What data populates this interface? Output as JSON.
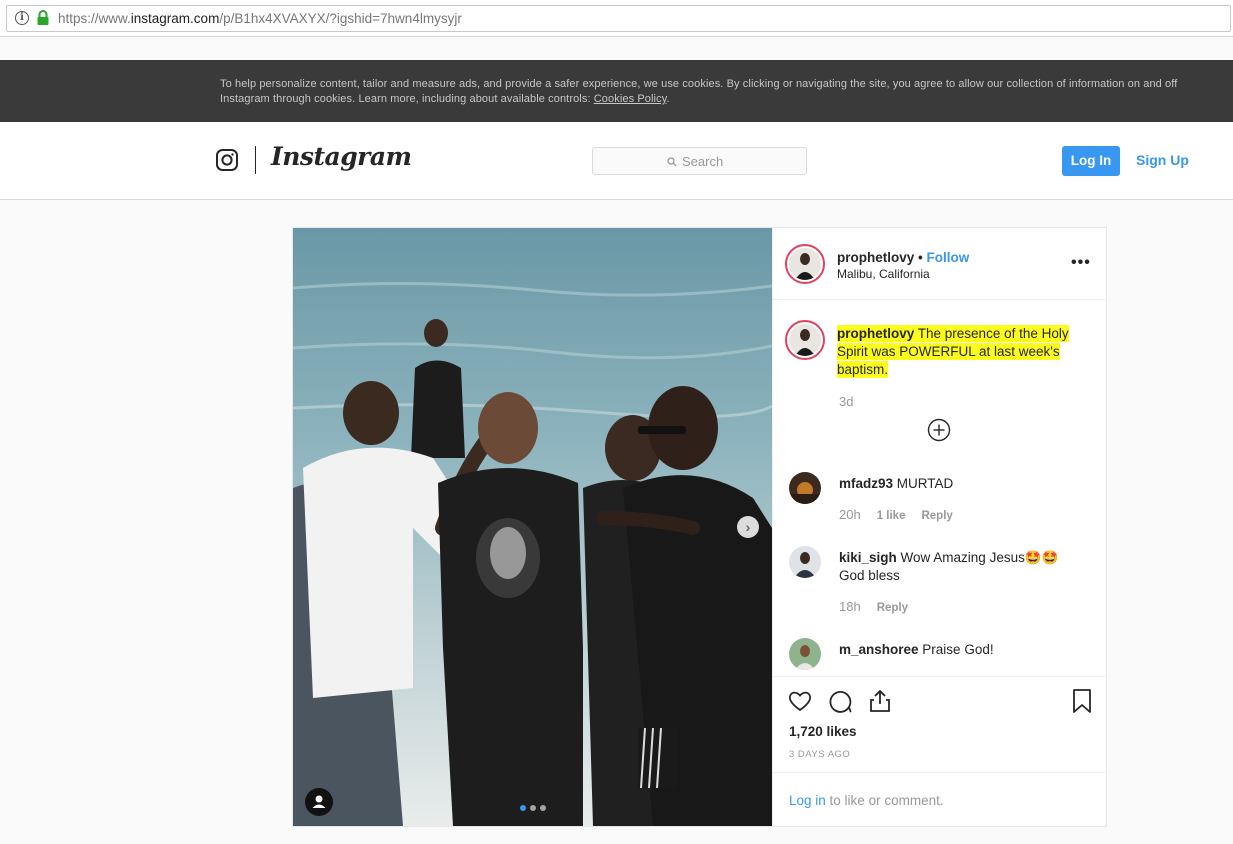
{
  "browser": {
    "url_prefix": "https://www.",
    "url_host": "instagram.com",
    "url_rest": "/p/B1hx4XVAXYX/?igshid=7hwn4lmysyjr"
  },
  "cookie_banner": {
    "text": "To help personalize content, tailor and measure ads, and provide a safer experience, we use cookies. By clicking or navigating the site, you agree to allow our collection of information on and off Instagram through cookies. Learn more, including about available controls: ",
    "link": "Cookies Policy",
    "end": "."
  },
  "header": {
    "wordmark": "Instagram",
    "search_placeholder": "Search",
    "login_label": "Log In",
    "signup_label": "Sign Up",
    "accent": "#3897f0"
  },
  "post": {
    "username": "prophetlovy",
    "separator": "•",
    "follow_label": "Follow",
    "location": "Malibu, California",
    "more_icon": "more-icon",
    "caption_user": "prophetlovy",
    "caption_text": " The presence of the Holy Spirit was POWERFUL at last week's baptism.",
    "caption_time": "3d",
    "highlight_color": "#fcfc1c",
    "comments": [
      {
        "user": "mfadz93",
        "text": " MURTAD",
        "time": "20h",
        "likes": "1 like",
        "reply": "Reply"
      },
      {
        "user": "kiki_sigh",
        "text": " Wow Amazing Jesus🤩🤩 God bless",
        "time": "18h",
        "reply": "Reply"
      },
      {
        "user": "m_anshoree",
        "text": " Praise God!"
      }
    ],
    "likes": "1,720 likes",
    "ago": "3 DAYS AGO",
    "login_link": "Log in",
    "login_suffix": " to like or comment."
  }
}
